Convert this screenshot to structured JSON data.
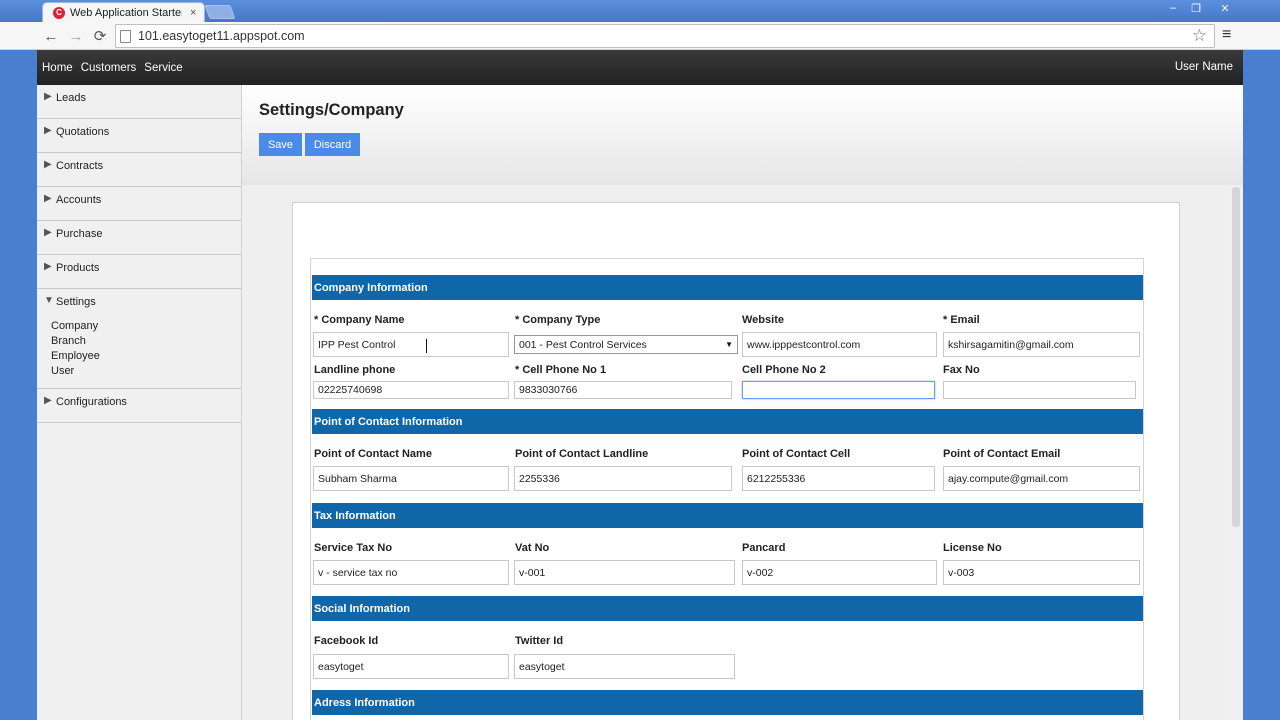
{
  "browser": {
    "tab_title": "Web Application Starter P",
    "tab_close": "×",
    "favicon_letter": "C",
    "url": "101.easytoget11.appspot.com",
    "win_min": "–",
    "win_max": "❐",
    "win_close": "✕"
  },
  "topnav": {
    "links": [
      "Home",
      "Customers",
      "Service"
    ],
    "user": "User Name"
  },
  "sidebar": {
    "items": [
      {
        "label": "Leads"
      },
      {
        "label": "Quotations"
      },
      {
        "label": "Contracts"
      },
      {
        "label": "Accounts"
      },
      {
        "label": "Purchase"
      },
      {
        "label": "Products"
      },
      {
        "label": "Settings",
        "sub": [
          "Company",
          "Branch",
          "Employee",
          "User"
        ]
      },
      {
        "label": "Configurations"
      }
    ]
  },
  "page": {
    "title": "Settings/Company",
    "save": "Save",
    "discard": "Discard"
  },
  "sections": {
    "company": "Company Information",
    "contact": "Point of Contact Information",
    "tax": "Tax Information",
    "social": "Social Information",
    "address": "Adress Information"
  },
  "company": {
    "name_label": "* Company Name",
    "name": "IPP Pest Control",
    "type_label": "* Company Type",
    "type": "001 - Pest Control Services",
    "website_label": "Website",
    "website": "www.ipppestcontrol.com",
    "email_label": "* Email",
    "email": "kshirsagamitin@gmail.com",
    "landline_label": "Landline phone",
    "landline": "02225740698",
    "cell1_label": "* Cell Phone No 1",
    "cell1": "9833030766",
    "cell2_label": "Cell Phone No 2",
    "cell2": "",
    "fax_label": "Fax No",
    "fax": ""
  },
  "contact": {
    "name_label": "Point of Contact Name",
    "name": "Subham Sharma",
    "landline_label": "Point of Contact Landline",
    "landline": "2255336",
    "cell_label": "Point of Contact Cell",
    "cell": "6212255336",
    "email_label": "Point of Contact Email",
    "email": "ajay.compute@gmail.com"
  },
  "tax": {
    "service_label": "Service Tax No",
    "service": "v - service tax no",
    "vat_label": "Vat No",
    "vat": "v-001",
    "pan_label": "Pancard",
    "pan": "v-002",
    "license_label": "License No",
    "license": "v-003"
  },
  "social": {
    "facebook_label": "Facebook Id",
    "facebook": "easytoget",
    "twitter_label": "Twitter Id",
    "twitter": "easytoget"
  }
}
